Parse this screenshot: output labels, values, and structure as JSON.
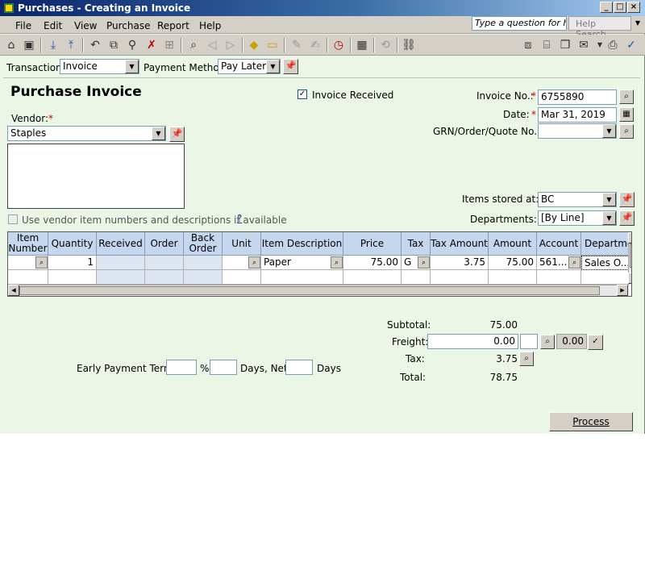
{
  "window": {
    "title": "Purchases - Creating an Invoice"
  },
  "menu": [
    "File",
    "Edit",
    "View",
    "Purchase",
    "Report",
    "Help"
  ],
  "help": {
    "placeholder": "Type a question for help",
    "search_label": "Help Search"
  },
  "transaction": {
    "label": "Transaction:",
    "value": "Invoice"
  },
  "payment_method": {
    "label": "Payment Method:",
    "value": "Pay Later"
  },
  "form": {
    "title": "Purchase Invoice",
    "invoice_received_label": "Invoice Received",
    "vendor_label": "Vendor:",
    "vendor_value": "Staples",
    "invoice_no_label": "Invoice No.:",
    "invoice_no_value": "6755890",
    "date_label": "Date:",
    "date_value": "Mar 31, 2019",
    "grn_label": "GRN/Order/Quote No.:",
    "grn_value": "",
    "items_stored_label": "Items stored at:",
    "items_stored_value": "BC",
    "departments_label": "Departments:",
    "departments_value": "[By Line]",
    "use_vendor_items_label": "Use vendor item numbers and descriptions if available",
    "help_q": "?",
    "required_mark": "*"
  },
  "grid": {
    "headers": [
      "Item Number",
      "Quantity",
      "Received",
      "Order",
      "Back Order",
      "Unit",
      "Item Description",
      "Price",
      "Tax",
      "Tax Amount",
      "Amount",
      "Account",
      "Departme"
    ],
    "rows": [
      {
        "item_number": "",
        "quantity": "1",
        "received": "",
        "order": "",
        "back_order": "",
        "unit": "",
        "description": "Paper",
        "price": "75.00",
        "tax": "G",
        "tax_amount": "3.75",
        "amount": "75.00",
        "account": "561...",
        "department": "Sales O..."
      }
    ]
  },
  "totals": {
    "subtotal_label": "Subtotal:",
    "subtotal_value": "75.00",
    "freight_label": "Freight:",
    "freight_value": "0.00",
    "freight_tax_value": "0.00",
    "tax_label": "Tax:",
    "tax_value": "3.75",
    "total_label": "Total:",
    "total_value": "78.75"
  },
  "terms": {
    "label": "Early Payment Terms:",
    "pct": "%",
    "days": "Days, Net",
    "days2": "Days"
  },
  "process_label": "Process"
}
